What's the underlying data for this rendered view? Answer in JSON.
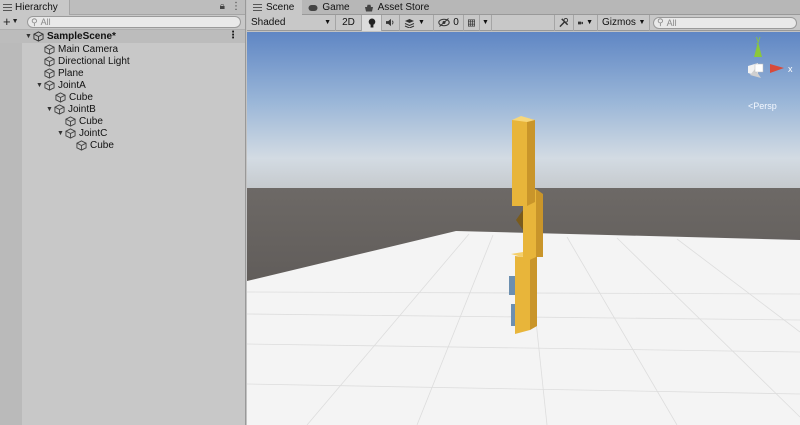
{
  "hierarchy": {
    "tab_label": "Hierarchy",
    "search_placeholder": "All",
    "scene": "SampleScene*",
    "items": [
      {
        "label": "Main Camera"
      },
      {
        "label": "Directional Light"
      },
      {
        "label": "Plane"
      },
      {
        "label": "JointA"
      },
      {
        "label": "Cube"
      },
      {
        "label": "JointB"
      },
      {
        "label": "Cube"
      },
      {
        "label": "JointC"
      },
      {
        "label": "Cube"
      }
    ]
  },
  "scene_tabs": [
    {
      "label": "Scene"
    },
    {
      "label": "Game"
    },
    {
      "label": "Asset Store"
    }
  ],
  "scene_toolbar": {
    "shading_mode": "Shaded",
    "mode_2d": "2D",
    "hidden_count": "0",
    "gizmos": "Gizmos",
    "search_placeholder": "All"
  },
  "gizmo": {
    "axis_y": "y",
    "axis_x": "x",
    "projection": "Persp"
  },
  "colors": {
    "cube": "#e8b53a",
    "sky_top": "#5f86c4",
    "ground": "#5a5654"
  }
}
